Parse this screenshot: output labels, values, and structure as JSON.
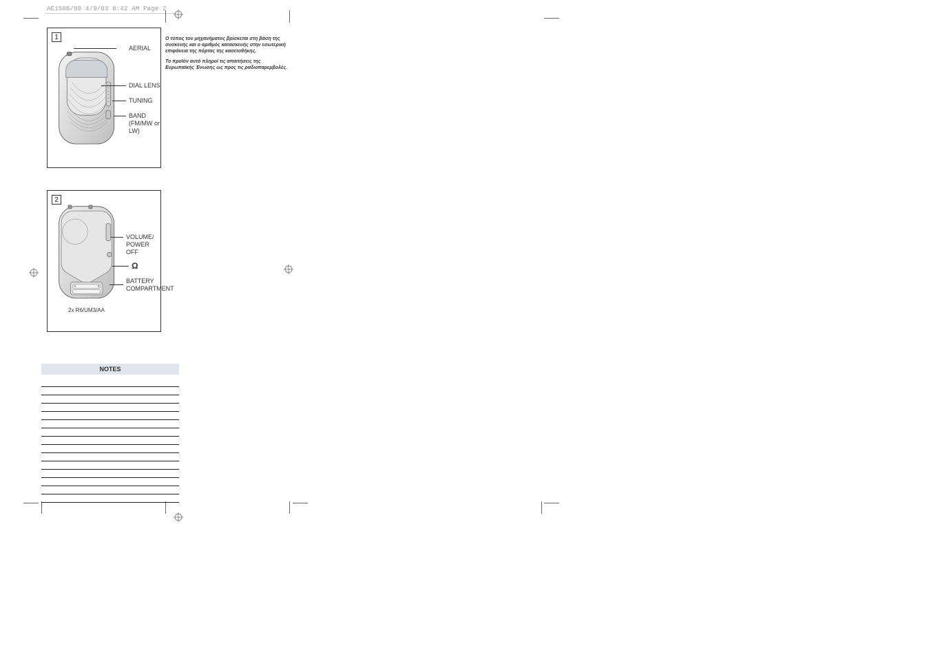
{
  "page_id": "AE1506/00  4/9/03  0:42 AM  Page 2",
  "panel1": {
    "num": "1",
    "labels": {
      "aerial": "AERIAL",
      "dial_lens": "DIAL LENS",
      "tuning": "TUNING",
      "band": "BAND",
      "band_sub": "(FM/MW or LW)"
    }
  },
  "panel2": {
    "num": "2",
    "labels": {
      "volume": "VOLUME/",
      "power_off": "POWER OFF",
      "headphone": "Ω",
      "battery": "BATTERY",
      "compartment": "COMPARTMENT",
      "battery_note": "2x R6/UM3/AA"
    }
  },
  "greek": {
    "para1": "Ο τύπος του μηχανήματος βρίσκεται στη βάση της συσκευής και ο αριθμός κατασκευής στην εσωτερική επιφάνεια της πόρτας της κασετοθήκης.",
    "para2": "Το προϊόν αυτό πληροί τις απαιτήσεις της Ευρωπαϊκής Ένωσης ως προς τις ραδιοπαρεμβολές."
  },
  "notes_heading": "NOTES"
}
